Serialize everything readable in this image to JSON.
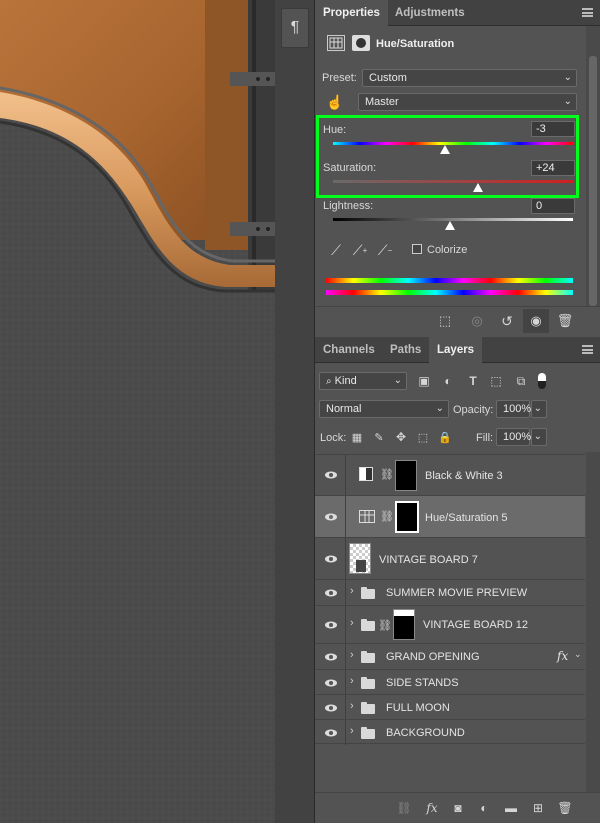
{
  "strip": {
    "paragraph_icon": "¶"
  },
  "properties": {
    "tabs": [
      {
        "label": "Properties",
        "active": true
      },
      {
        "label": "Adjustments",
        "active": false
      }
    ],
    "adjustment_title": "Hue/Saturation",
    "preset_label": "Preset:",
    "preset_value": "Custom",
    "channel_value": "Master",
    "hue_label": "Hue:",
    "hue_value": "-3",
    "saturation_label": "Saturation:",
    "saturation_value": "+24",
    "lightness_label": "Lightness:",
    "lightness_value": "0",
    "colorize_label": "Colorize",
    "colorize_checked": false,
    "highlight_color": "#00ff1a"
  },
  "layers_panel": {
    "tabs": [
      {
        "label": "Channels",
        "active": false
      },
      {
        "label": "Paths",
        "active": false
      },
      {
        "label": "Layers",
        "active": true
      }
    ],
    "filter_kind": "Kind",
    "blend_mode": "Normal",
    "opacity_label": "Opacity:",
    "opacity_value": "100%",
    "lock_label": "Lock:",
    "fill_label": "Fill:",
    "fill_value": "100%",
    "layers": [
      {
        "name": "Black & White 3",
        "kind": "adjustment",
        "selected": false
      },
      {
        "name": "Hue/Saturation 5",
        "kind": "adjustment",
        "selected": true
      },
      {
        "name": "VINTAGE BOARD 7",
        "kind": "smart",
        "selected": false
      },
      {
        "name": "SUMMER MOVIE PREVIEW",
        "kind": "group",
        "selected": false
      },
      {
        "name": "VINTAGE BOARD 12",
        "kind": "masked-group",
        "selected": false
      },
      {
        "name": "GRAND OPENING",
        "kind": "group-fx",
        "selected": false
      },
      {
        "name": "SIDE STANDS",
        "kind": "group",
        "selected": false
      },
      {
        "name": "FULL MOON",
        "kind": "group",
        "selected": false
      },
      {
        "name": "BACKGROUND",
        "kind": "group",
        "selected": false
      }
    ],
    "fx_label": "fx"
  }
}
